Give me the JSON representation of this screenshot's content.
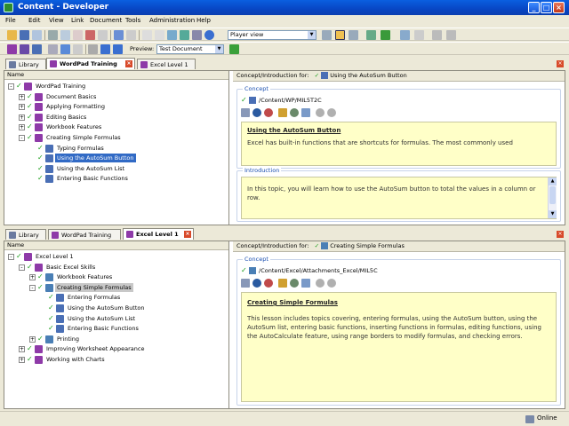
{
  "window": {
    "title": "Content - Developer"
  },
  "menu": [
    "File",
    "Edit",
    "View",
    "Link",
    "Document",
    "Tools",
    "Administration",
    "Help"
  ],
  "toolbar": {
    "view_select": "Player view",
    "preview_label": "Preview:",
    "preview_select": "Test Document"
  },
  "top": {
    "tabs": [
      {
        "label": "Library",
        "active": false
      },
      {
        "label": "WordPad Training",
        "active": true,
        "closable": true
      },
      {
        "label": "Excel Level 1",
        "active": false
      }
    ],
    "tree_header": "Name",
    "tree": [
      {
        "label": "WordPad Training",
        "level": 0,
        "expander": "-"
      },
      {
        "label": "Document Basics",
        "level": 1,
        "expander": "+"
      },
      {
        "label": "Applying Formatting",
        "level": 1,
        "expander": "+"
      },
      {
        "label": "Editing Basics",
        "level": 1,
        "expander": "+"
      },
      {
        "label": "Workbook Features",
        "level": 1,
        "expander": "+"
      },
      {
        "label": "Creating Simple Formulas",
        "level": 1,
        "expander": "-"
      },
      {
        "label": "Typing Formulas",
        "level": 2
      },
      {
        "label": "Using the AutoSum Button",
        "level": 2,
        "selected": true
      },
      {
        "label": "Using the AutoSum List",
        "level": 2
      },
      {
        "label": "Entering Basic Functions",
        "level": 2
      }
    ],
    "intro_for_label": "Concept/Introduction for:",
    "intro_for_value": "Using the AutoSum Button",
    "concept_label": "Concept",
    "concept_path": "/Content/WP/MIL5T2C",
    "concept_title": "Using the AutoSum Button",
    "concept_text": "Excel has built-in functions that are shortcuts for formulas. The most commonly used",
    "introduction_label": "Introduction",
    "introduction_text": "In this topic, you will learn how to use the AutoSum button to total the values in a column or row."
  },
  "bottom": {
    "tabs": [
      {
        "label": "Library",
        "active": false
      },
      {
        "label": "WordPad Training",
        "active": false
      },
      {
        "label": "Excel Level 1",
        "active": true,
        "closable": true
      }
    ],
    "tree_header": "Name",
    "tree": [
      {
        "label": "Excel Level 1",
        "level": 0,
        "expander": "-"
      },
      {
        "label": "Basic Excel Skills",
        "level": 1,
        "expander": "-"
      },
      {
        "label": "Workbook Features",
        "level": 2,
        "expander": "+"
      },
      {
        "label": "Creating Simple Formulas",
        "level": 2,
        "expander": "-",
        "highlighted": true
      },
      {
        "label": "Entering Formulas",
        "level": 3
      },
      {
        "label": "Using the AutoSum Button",
        "level": 3
      },
      {
        "label": "Using the AutoSum List",
        "level": 3
      },
      {
        "label": "Entering Basic Functions",
        "level": 3
      },
      {
        "label": "Printing",
        "level": 2,
        "expander": "+"
      },
      {
        "label": "Improving Worksheet Appearance",
        "level": 1,
        "expander": "+"
      },
      {
        "label": "Working with Charts",
        "level": 1,
        "expander": "+"
      }
    ],
    "intro_for_label": "Concept/Introduction for:",
    "intro_for_value": "Creating Simple Formulas",
    "concept_label": "Concept",
    "concept_path": "/Content/Excel/Attachments_Excel/MIL5C",
    "concept_title": "Creating Simple Formulas",
    "concept_text": "This lesson includes topics covering, entering formulas, using the AutoSum button, using the AutoSum list, entering basic functions, inserting functions in formulas, editing functions, using the AutoCalculate feature, using range borders to modify formulas, and checking errors."
  },
  "status": {
    "text": "Online"
  },
  "colors": {
    "titlebar": "#0a5fe0",
    "selection": "#316ac5",
    "concept_bg": "#ffffc8",
    "check": "#1b9e1b",
    "book": "#8e3aa8"
  }
}
